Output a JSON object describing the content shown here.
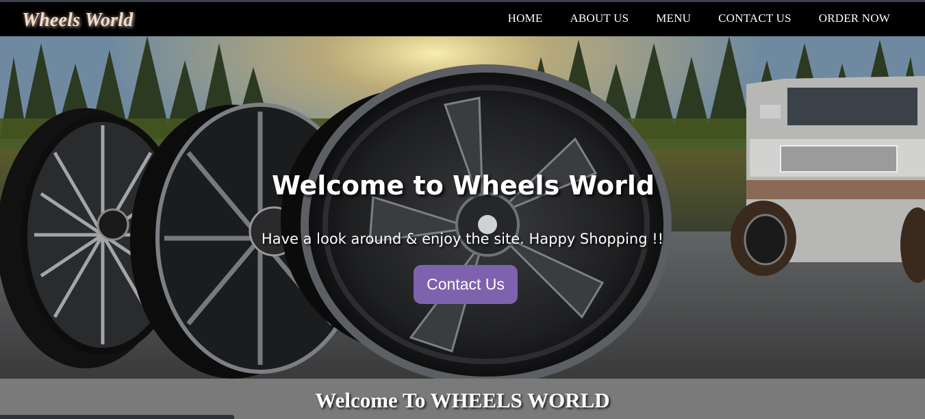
{
  "brand": "Wheels World",
  "nav": [
    "HOME",
    "ABOUT US",
    "MENU",
    "CONTACT US",
    "ORDER NOW"
  ],
  "hero": {
    "title": "Welcome to Wheels World",
    "subtitle": "Have a look around & enjoy the site. Happy Shopping !!",
    "cta": "Contact Us",
    "image": "Custom wheels and lifted pickup truck beside a forest lake"
  },
  "section": {
    "title": "Welcome To WHEELS WORLD"
  },
  "colors": {
    "header_bg": "#000000",
    "accent": "#7f62ad",
    "section_bg": "#7a7a7a"
  }
}
